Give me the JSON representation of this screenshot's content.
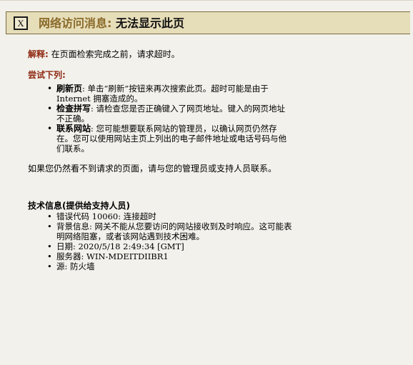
{
  "header": {
    "icon_glyph": "X",
    "title_prefix": "网络访问消息:",
    "title_main": "无法显示此页"
  },
  "explanation": {
    "label": "解释:",
    "text": "在页面检索完成之前，请求超时。"
  },
  "try": {
    "heading": "尝试下列:",
    "items": [
      {
        "label": "刷新页",
        "text": ": 单击“刷新”按钮来再次搜索此页。超时可能是由于 Internet 拥塞造成的。"
      },
      {
        "label": "检查拼写",
        "text": ": 请检查您是否正确键入了网页地址。键入的网页地址不正确。"
      },
      {
        "label": "联系网站",
        "text": ": 您可能想要联系网站的管理员，以确认网页仍然存在。您可以使用网站主页上列出的电子邮件地址或电话号码与他们联系。"
      }
    ]
  },
  "contact_text": "如果您仍然看不到请求的页面，请与您的管理员或支持人员联系。",
  "tech": {
    "heading": "技术信息(提供给支持人员)",
    "items": [
      "错误代码 10060: 连接超时",
      "背景信息: 网关不能从您要访问的网站接收到及时响应。这可能表明网络阻塞，或者该网站遇到技术困难。",
      "日期: 2020/5/18 2:49:34 [GMT]",
      "服务器: WIN-MDEITDIIBR1",
      "源: 防火墙"
    ]
  },
  "colors": {
    "background": "#f2f1ec",
    "title_bar": "#e6ddb9",
    "title_border": "#7a6b3e",
    "title_prefix": "#8a6a2a",
    "label_red": "#8f2a12"
  }
}
